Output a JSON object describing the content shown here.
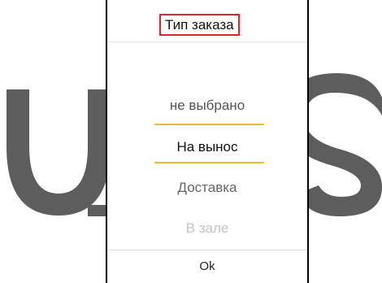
{
  "watermark": {
    "text": "U_S",
    "color": "#5d5d5d"
  },
  "dialog": {
    "title": "Тип заказа",
    "title_highlight_color": "#e0252b",
    "selection_line_color": "#f2bd2d",
    "options": [
      {
        "label": "не выбрано",
        "state": "above"
      },
      {
        "label": "На вынос",
        "state": "selected"
      },
      {
        "label": "Доставка",
        "state": "below"
      },
      {
        "label": "В зале",
        "state": "faded"
      }
    ],
    "selected_value": "На вынос",
    "ok_label": "Ok"
  }
}
